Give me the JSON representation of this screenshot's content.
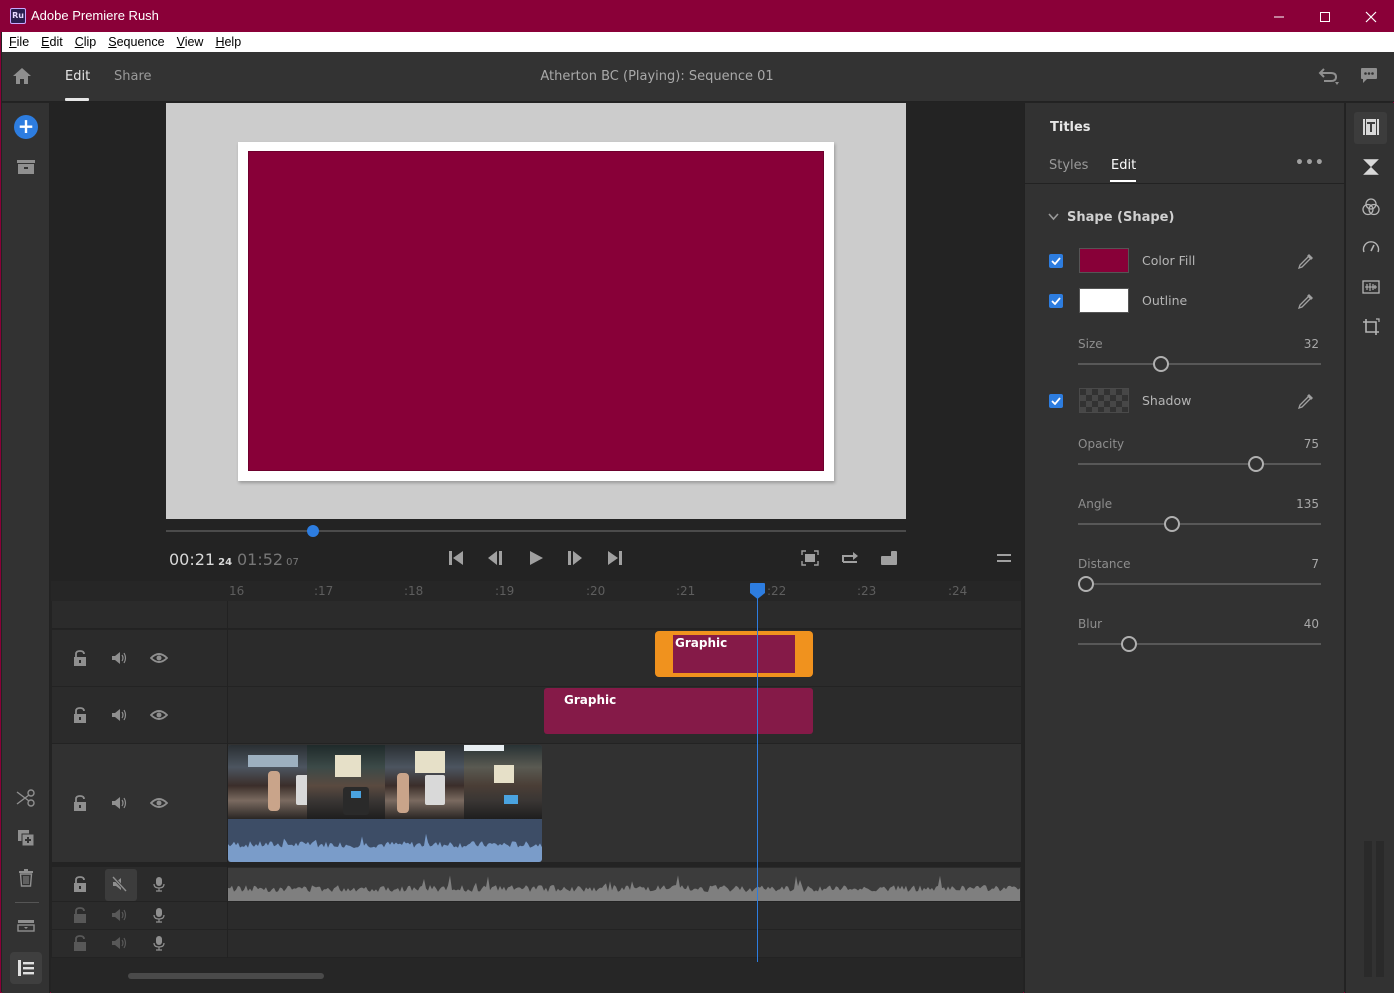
{
  "window": {
    "app_title": "Adobe Premiere Rush",
    "app_icon_text": "Ru",
    "controls": [
      "minimize",
      "maximize",
      "close"
    ]
  },
  "menu": {
    "items": [
      {
        "label": "File",
        "accel": "F"
      },
      {
        "label": "Edit",
        "accel": "E"
      },
      {
        "label": "Clip",
        "accel": "C"
      },
      {
        "label": "Sequence",
        "accel": "S"
      },
      {
        "label": "View",
        "accel": "V"
      },
      {
        "label": "Help",
        "accel": "H"
      }
    ]
  },
  "header": {
    "tabs": [
      {
        "label": "Edit",
        "active": true
      },
      {
        "label": "Share",
        "active": false
      }
    ],
    "sequence_title": "Atherton BC (Playing): Sequence 01"
  },
  "colors": {
    "accent": "#2d7de0",
    "brand": "#8a0038",
    "shape_fill": "#880038",
    "selected_clip": "#f0921e",
    "graphic_clip": "#851a48"
  },
  "player": {
    "current_time": "00:21",
    "current_frames": "24",
    "duration": "01:52",
    "duration_frames": "07",
    "scrub_progress": 0.198
  },
  "timeline": {
    "ruler_ticks": [
      "16",
      ":17",
      ":18",
      ":19",
      ":20",
      ":21",
      ":22",
      ":23",
      ":24"
    ],
    "tracks": [
      {
        "type": "graphic",
        "clips": [
          {
            "label": "Graphic",
            "selected": true
          }
        ]
      },
      {
        "type": "graphic",
        "clips": [
          {
            "label": "Graphic",
            "selected": false
          }
        ]
      },
      {
        "type": "video",
        "clips": [
          {
            "label": "",
            "selected": false
          }
        ]
      },
      {
        "type": "audio",
        "muted": true
      },
      {
        "type": "audio",
        "muted": false
      },
      {
        "type": "audio",
        "muted": false
      }
    ]
  },
  "panel": {
    "title": "Titles",
    "tabs": [
      {
        "label": "Styles",
        "active": false
      },
      {
        "label": "Edit",
        "active": true
      }
    ],
    "more_label": "•••",
    "section_title": "Shape (Shape)",
    "properties": [
      {
        "label": "Color Fill",
        "checked": true,
        "swatch": "#880038"
      },
      {
        "label": "Outline",
        "checked": true,
        "swatch": "#ffffff"
      },
      {
        "label": "Shadow",
        "checked": true,
        "swatch": "#444444"
      }
    ],
    "sliders": {
      "size": {
        "label": "Size",
        "value": "32",
        "pos": 0.33
      },
      "opacity": {
        "label": "Opacity",
        "value": "75",
        "pos": 0.75
      },
      "angle": {
        "label": "Angle",
        "value": "135",
        "pos": 0.38
      },
      "distance": {
        "label": "Distance",
        "value": "7",
        "pos": 0.0
      },
      "blur": {
        "label": "Blur",
        "value": "40",
        "pos": 0.19
      }
    }
  }
}
